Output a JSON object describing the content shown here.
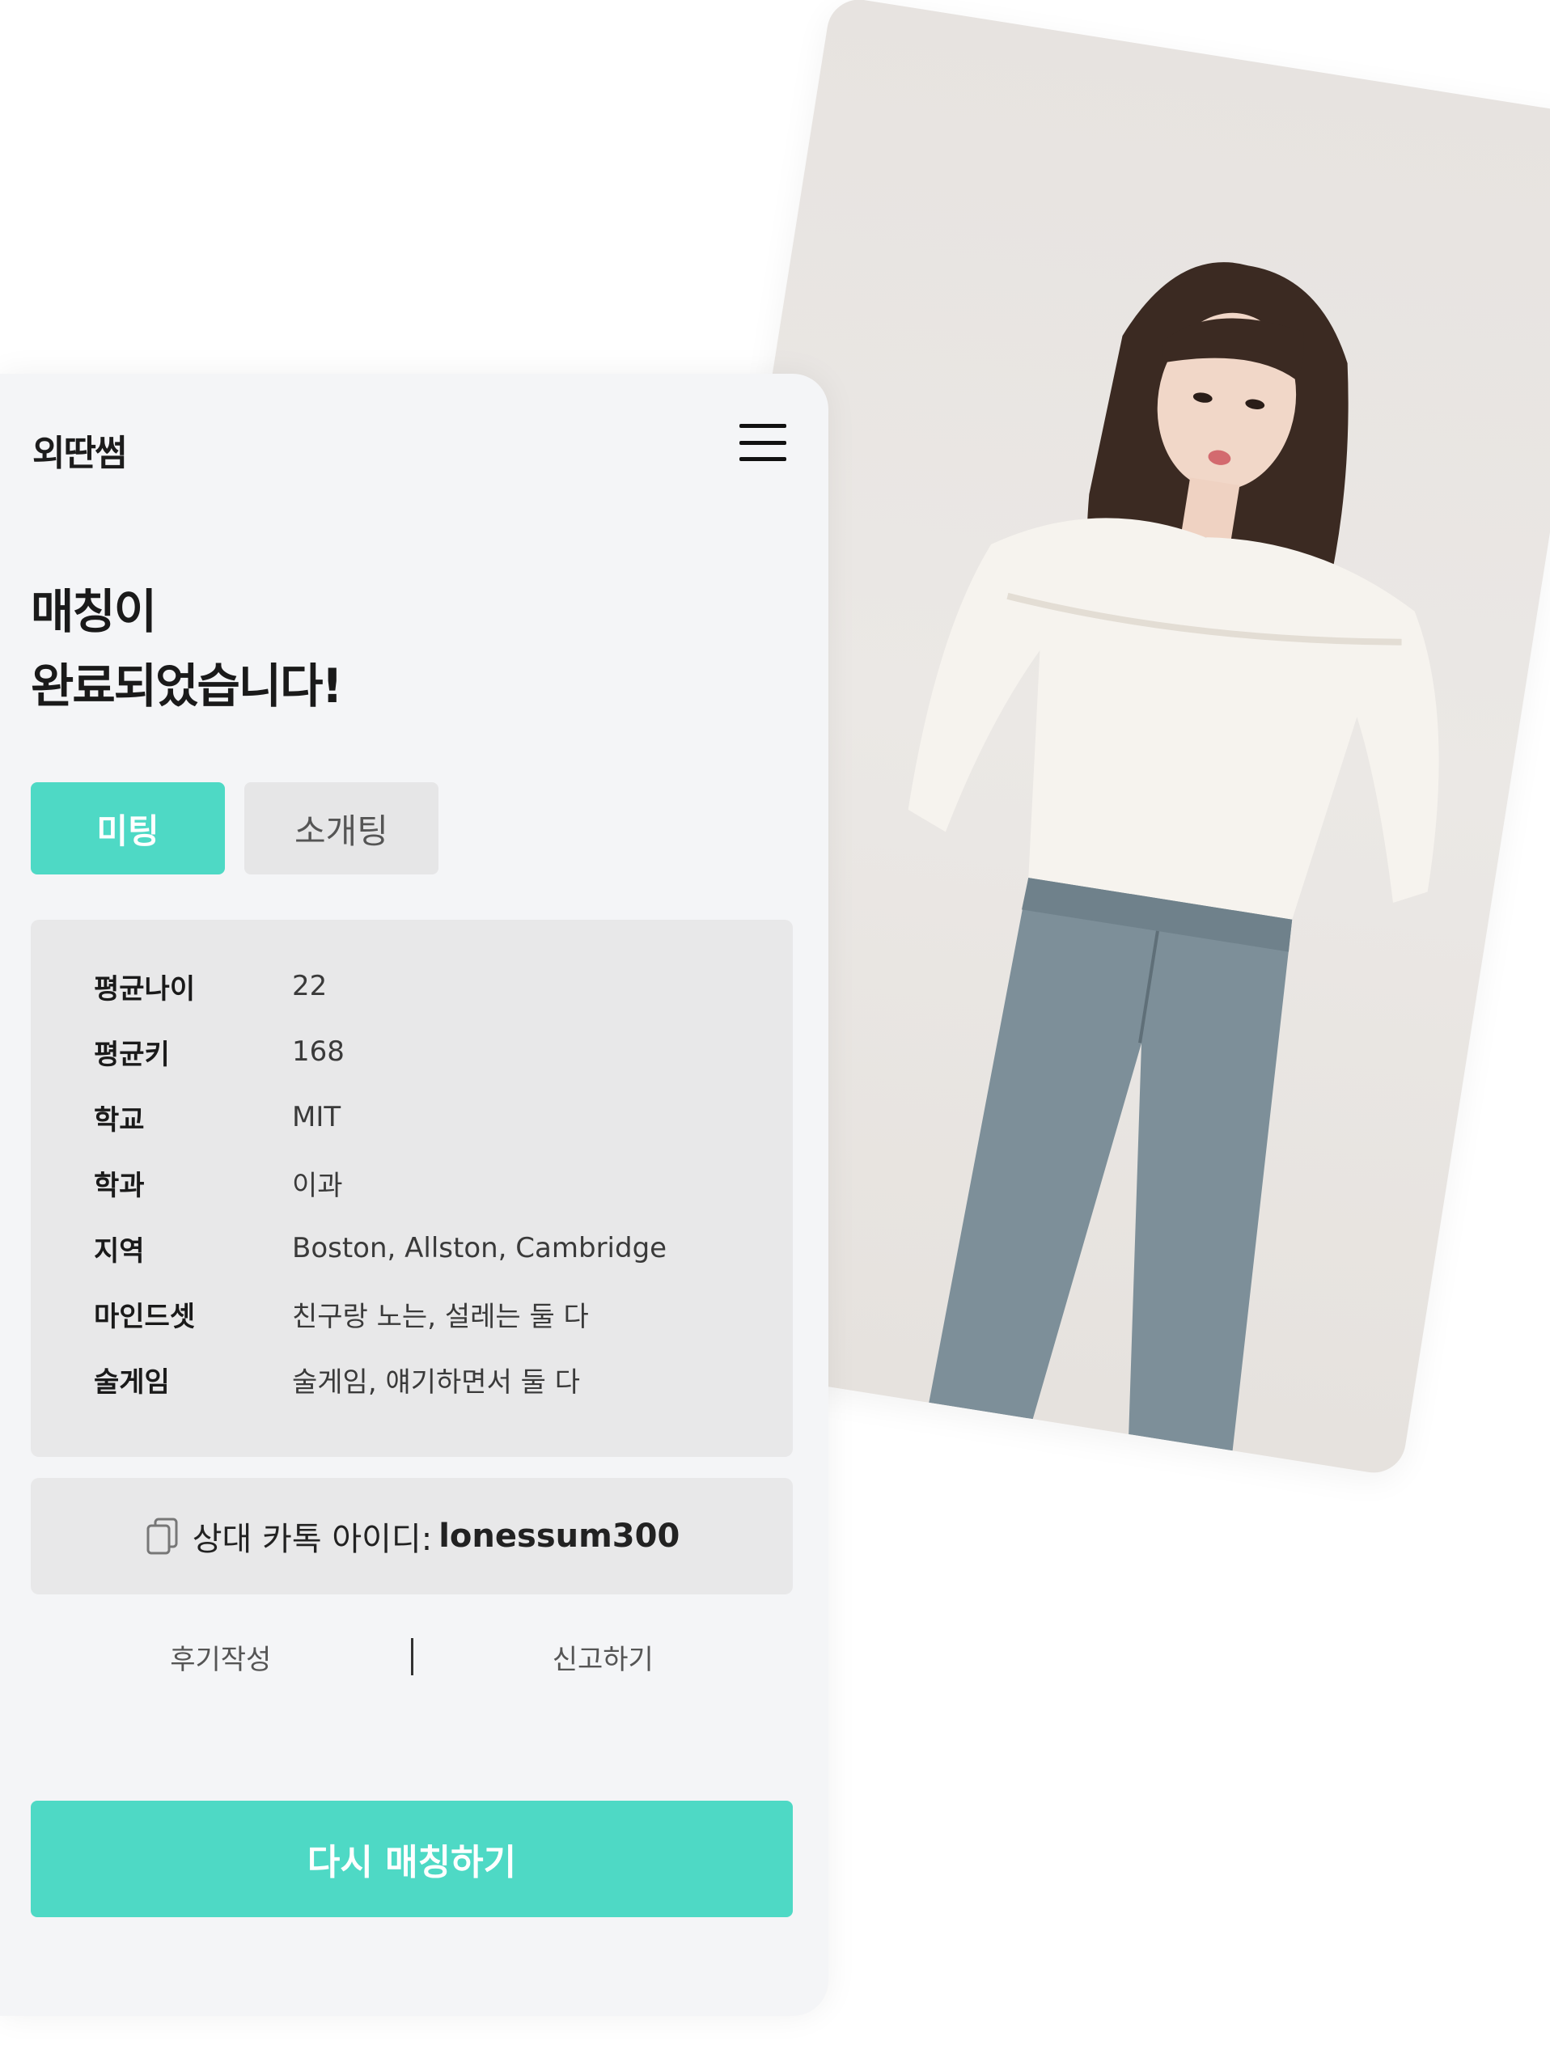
{
  "app": {
    "logo": "외딴썸"
  },
  "header": {
    "menu_icon": "hamburger-menu-icon"
  },
  "main": {
    "headline_line1": "매칭이",
    "headline_line2": "완료되었습니다!",
    "tabs": [
      {
        "label": "미팅",
        "active": true
      },
      {
        "label": "소개팅",
        "active": false
      }
    ],
    "info": [
      {
        "label": "평균나이",
        "value": "22"
      },
      {
        "label": "평균키",
        "value": "168"
      },
      {
        "label": "학교",
        "value": "MIT"
      },
      {
        "label": "학과",
        "value": "이과"
      },
      {
        "label": "지역",
        "value": "Boston, Allston, Cambridge"
      },
      {
        "label": "마인드셋",
        "value": "친구랑 노는, 설레는 둘 다"
      },
      {
        "label": "술게임",
        "value": "술게임, 얘기하면서 둘 다"
      }
    ],
    "kakao": {
      "icon": "copy-icon",
      "label": "상대 카톡 아이디:",
      "id": "lonessum300"
    },
    "links": {
      "review": "후기작성",
      "report": "신고하기"
    },
    "cta": "다시 매칭하기"
  },
  "colors": {
    "accent": "#4ed9c5",
    "panel": "#f4f5f7",
    "box": "#e8e8e9"
  },
  "photo": {
    "icon": "profile-photo"
  }
}
